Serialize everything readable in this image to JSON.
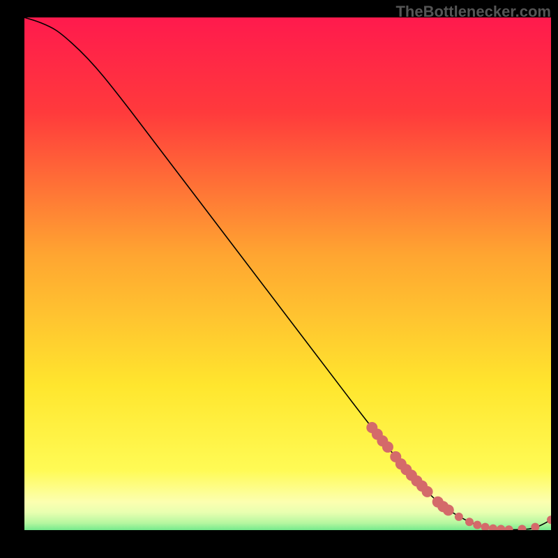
{
  "watermark": "TheBottlenecker.com",
  "chart_data": {
    "type": "line",
    "title": "",
    "xlabel": "",
    "ylabel": "",
    "xlim": [
      0,
      100
    ],
    "ylim": [
      0,
      100
    ],
    "gradient_stops": [
      {
        "pos": 0,
        "color": "#ff1a4d"
      },
      {
        "pos": 18,
        "color": "#ff3a3c"
      },
      {
        "pos": 45,
        "color": "#ffa531"
      },
      {
        "pos": 70,
        "color": "#ffe62e"
      },
      {
        "pos": 86,
        "color": "#fffb55"
      },
      {
        "pos": 92,
        "color": "#fcffb0"
      },
      {
        "pos": 94,
        "color": "#e8ffb0"
      },
      {
        "pos": 96,
        "color": "#b6f7a0"
      },
      {
        "pos": 97.5,
        "color": "#6de88a"
      },
      {
        "pos": 99,
        "color": "#29d47a"
      },
      {
        "pos": 100,
        "color": "#18c66f"
      }
    ],
    "series": [
      {
        "name": "bottleneck-curve",
        "color": "#000000",
        "x": [
          0,
          3,
          6,
          9,
          12,
          15,
          20,
          30,
          40,
          50,
          60,
          66,
          72,
          78,
          82,
          86,
          90,
          94,
          97,
          100
        ],
        "y": [
          100,
          99,
          97.5,
          95,
          92,
          88.5,
          82,
          68.5,
          55,
          41.5,
          28,
          20,
          12.5,
          6,
          3,
          1,
          0.2,
          0.1,
          0.5,
          2
        ]
      }
    ],
    "markers": {
      "name": "highlighted-points",
      "color": "#d46a6a",
      "radius_large": 8,
      "radius_small": 6,
      "points": [
        {
          "x": 66.0,
          "y": 20.0,
          "r": "large"
        },
        {
          "x": 67.0,
          "y": 18.7,
          "r": "large"
        },
        {
          "x": 68.0,
          "y": 17.4,
          "r": "large"
        },
        {
          "x": 69.0,
          "y": 16.2,
          "r": "large"
        },
        {
          "x": 70.5,
          "y": 14.3,
          "r": "large"
        },
        {
          "x": 71.5,
          "y": 12.9,
          "r": "large"
        },
        {
          "x": 72.5,
          "y": 11.8,
          "r": "large"
        },
        {
          "x": 73.5,
          "y": 10.7,
          "r": "large"
        },
        {
          "x": 74.5,
          "y": 9.6,
          "r": "large"
        },
        {
          "x": 75.5,
          "y": 8.6,
          "r": "large"
        },
        {
          "x": 76.5,
          "y": 7.5,
          "r": "large"
        },
        {
          "x": 78.5,
          "y": 5.5,
          "r": "large"
        },
        {
          "x": 79.5,
          "y": 4.6,
          "r": "large"
        },
        {
          "x": 80.5,
          "y": 3.9,
          "r": "large"
        },
        {
          "x": 82.5,
          "y": 2.6,
          "r": "small"
        },
        {
          "x": 84.5,
          "y": 1.6,
          "r": "small"
        },
        {
          "x": 86.0,
          "y": 1.0,
          "r": "small"
        },
        {
          "x": 87.5,
          "y": 0.6,
          "r": "small"
        },
        {
          "x": 89.0,
          "y": 0.3,
          "r": "small"
        },
        {
          "x": 90.5,
          "y": 0.2,
          "r": "small"
        },
        {
          "x": 92.0,
          "y": 0.1,
          "r": "small"
        },
        {
          "x": 94.5,
          "y": 0.2,
          "r": "small"
        },
        {
          "x": 97.0,
          "y": 0.6,
          "r": "small"
        },
        {
          "x": 100.0,
          "y": 2.0,
          "r": "small"
        }
      ]
    }
  }
}
